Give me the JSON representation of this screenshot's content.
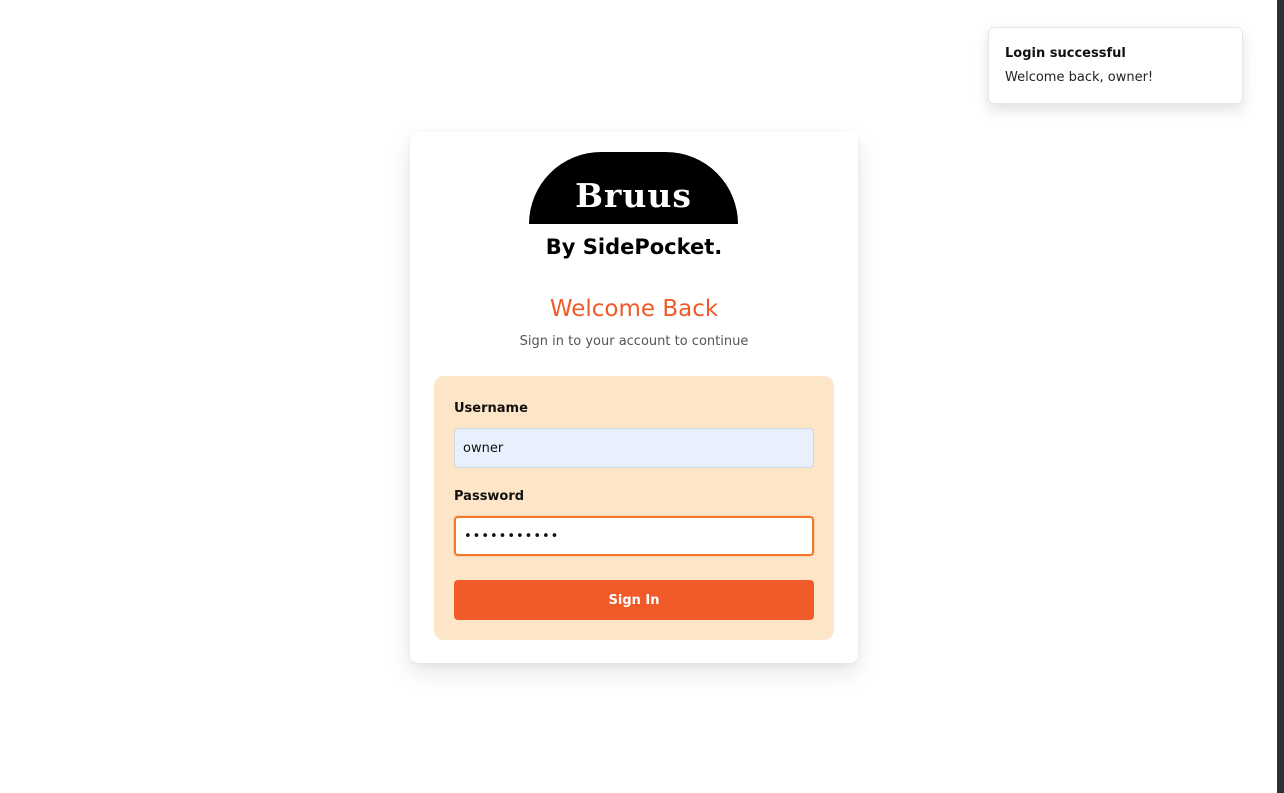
{
  "toast": {
    "title": "Login successful",
    "description": "Welcome back, owner!"
  },
  "brand": {
    "logo_text": "Bruus",
    "byline": "By SidePocket."
  },
  "login": {
    "heading": "Welcome Back",
    "subtitle": "Sign in to your account to continue",
    "username_label": "Username",
    "username_value": "owner",
    "password_label": "Password",
    "password_value": "•••••••••••",
    "submit_label": "Sign In"
  },
  "colors": {
    "accent": "#f05a28",
    "panel_background": "#fde5c7",
    "autofill_background": "#e8f0fe"
  }
}
